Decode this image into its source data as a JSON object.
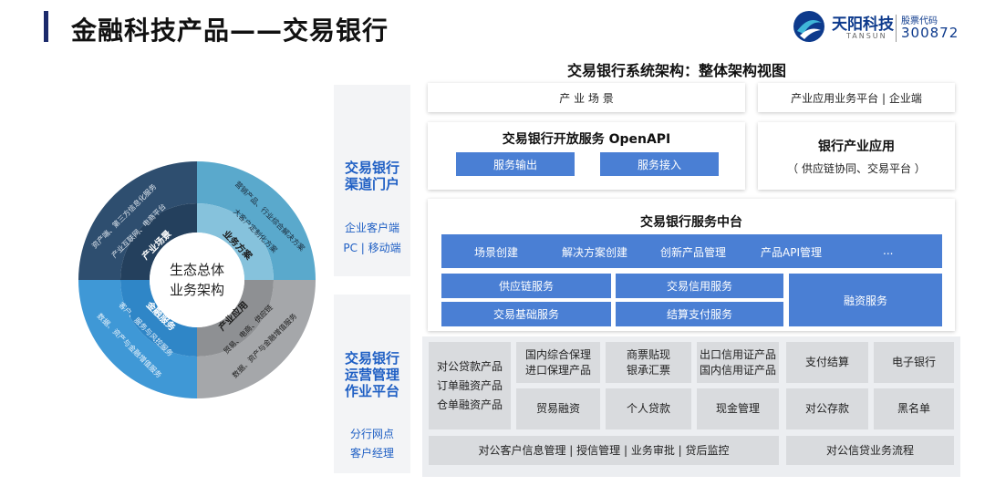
{
  "header": {
    "title": "金融科技产品——交易银行",
    "logo_cn": "天阳科技",
    "logo_en": "TANSUN",
    "stock_label": "股票代码",
    "stock_code": "300872"
  },
  "arch_title": "交易银行系统架构：整体架构视图",
  "ecosystem": {
    "center_line1": "生态总体",
    "center_line2": "业务架构",
    "q1_inner": "产业场景",
    "q1_outer1": "资产端、第三方信息化服务",
    "q1_outer2": "产业互联网、电商平台",
    "q2_inner": "业务方案",
    "q2_outer1": "营销产品、行业综合解决方案",
    "q2_outer2": "大客户定制化方案",
    "q3_inner": "产业应用",
    "q3_outer1": "贸易、电商、供应链",
    "q3_outer2": "数据、资产与金融增值服务",
    "q4_inner": "金融服务",
    "q4_outer1": "客户、服务与风控服务",
    "q4_outer2": "数据、资产与金融增值服务",
    "colors": {
      "dark": "#2e4e6f",
      "teal": "#5aa9cc",
      "blue": "#3f98d6",
      "gray": "#a5a7aa"
    }
  },
  "left_panel": {
    "top_title_1": "交易银行",
    "top_title_2": "渠道门户",
    "top_sub_1": "企业客户端",
    "top_sub_2": "PC | 移动端",
    "bottom_title_1": "交易银行",
    "bottom_title_2": "运营管理",
    "bottom_title_3": "作业平台",
    "bottom_sub_1": "分行网点",
    "bottom_sub_2": "客户经理"
  },
  "channel": {
    "industry_scene": "产 业 场 景",
    "industry_platform": "产业应用业务平台 | 企业端",
    "openapi_title": "交易银行开放服务 OpenAPI",
    "service_out": "服务输出",
    "service_in": "服务接入",
    "bank_app_title": "银行产业应用",
    "bank_app_sub": "（ 供应链协同、交易平台 ）"
  },
  "middle": {
    "title": "交易银行服务中台",
    "row1": [
      "场景创建",
      "解决方案创建",
      "创新产品管理",
      "产品API管理",
      "..."
    ],
    "supply_chain": "供应链服务",
    "trade_credit": "交易信用服务",
    "trade_basic": "交易基础服务",
    "settlement": "结算支付服务",
    "financing": "融资服务"
  },
  "ops": {
    "corp_loan_1": "对公贷款产品",
    "corp_loan_2": "订单融资产品",
    "corp_loan_3": "仓单融资产品",
    "dom_factoring_1": "国内综合保理",
    "dom_factoring_2": "进口保理产品",
    "bill_1": "商票贴现",
    "bill_2": "银承汇票",
    "lc_1": "出口信用证产品",
    "lc_2": "国内信用证产品",
    "payment": "支付结算",
    "ebank": "电子银行",
    "trade_fin": "贸易融资",
    "personal_loan": "个人贷款",
    "cash_mgmt": "现金管理",
    "corp_deposit": "对公存款",
    "blacklist": "黑名单",
    "bottom_left": "对公客户信息管理 | 授信管理 | 业务审批 | 贷后监控",
    "bottom_right": "对公信贷业务流程"
  }
}
